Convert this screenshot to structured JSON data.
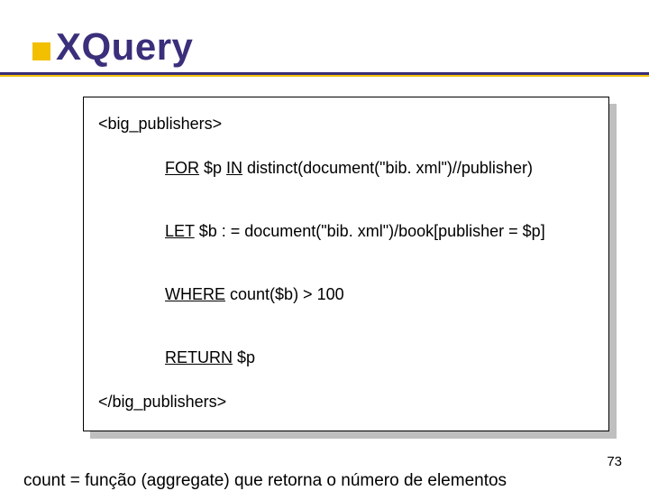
{
  "title": "XQuery",
  "code": {
    "open_tag": "<big_publishers>",
    "for_kw": "FOR",
    "for_var": " $p ",
    "in_kw": "IN",
    "for_rest": " distinct(document(\"bib. xml\")//publisher)",
    "let_kw": "LET",
    "let_rest": " $b : = document(\"bib. xml\")/book[publisher = $p]",
    "where_kw": "WHERE",
    "where_rest": " count($b) > 100",
    "return_kw": "RETURN",
    "return_rest": " $p",
    "close_tag": "</big_publishers>"
  },
  "caption": "count  = função (aggregate) que retorna o número de elementos",
  "page_number": "73"
}
